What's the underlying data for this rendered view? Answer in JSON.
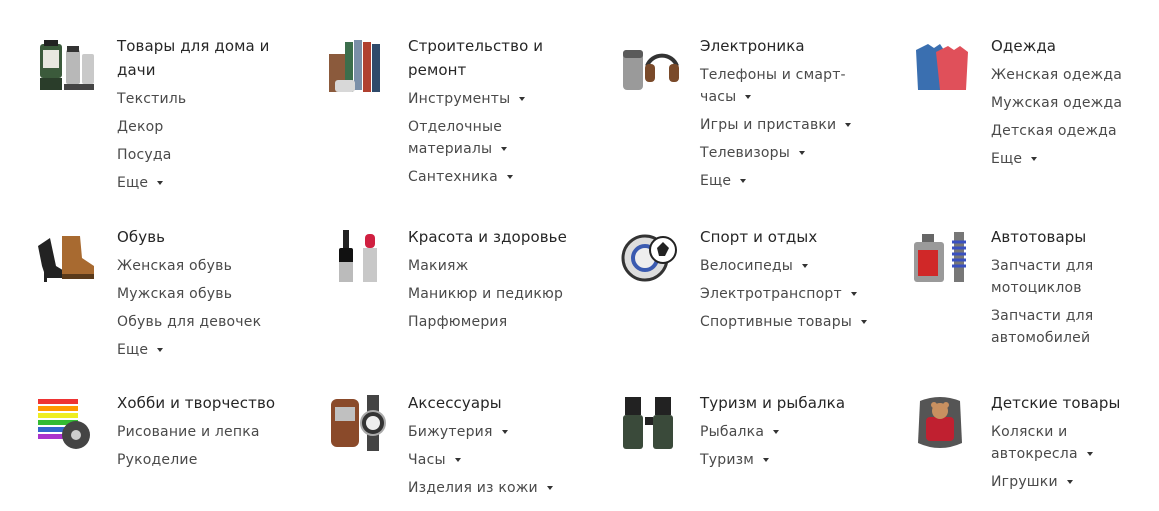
{
  "categories": [
    {
      "title": [
        "Товары для дома и",
        "дачи"
      ],
      "items": [
        {
          "lines": [
            "Текстиль"
          ],
          "arrow": false
        },
        {
          "lines": [
            "Декор"
          ],
          "arrow": false
        },
        {
          "lines": [
            "Посуда"
          ],
          "arrow": false
        },
        {
          "lines": [
            "Еще"
          ],
          "arrow": true
        }
      ]
    },
    {
      "title": [
        "Строительство и",
        "ремонт"
      ],
      "items": [
        {
          "lines": [
            "Инструменты"
          ],
          "arrow": true
        },
        {
          "lines": [
            "Отделочные",
            "материалы"
          ],
          "arrow": true
        },
        {
          "lines": [
            "Сантехника"
          ],
          "arrow": true
        }
      ]
    },
    {
      "title": [
        "Электроника"
      ],
      "items": [
        {
          "lines": [
            "Телефоны и смарт-",
            "часы"
          ],
          "arrow": true
        },
        {
          "lines": [
            "Игры и приставки"
          ],
          "arrow": true
        },
        {
          "lines": [
            "Телевизоры"
          ],
          "arrow": true
        },
        {
          "lines": [
            "Еще"
          ],
          "arrow": true
        }
      ]
    },
    {
      "title": [
        "Одежда"
      ],
      "items": [
        {
          "lines": [
            "Женская одежда"
          ],
          "arrow": false
        },
        {
          "lines": [
            "Мужская одежда"
          ],
          "arrow": false
        },
        {
          "lines": [
            "Детская одежда"
          ],
          "arrow": false
        },
        {
          "lines": [
            "Еще"
          ],
          "arrow": true
        }
      ]
    },
    {
      "title": [
        "Обувь"
      ],
      "items": [
        {
          "lines": [
            "Женская обувь"
          ],
          "arrow": false
        },
        {
          "lines": [
            "Мужская обувь"
          ],
          "arrow": false
        },
        {
          "lines": [
            "Обувь для девочек"
          ],
          "arrow": false
        },
        {
          "lines": [
            "Еще"
          ],
          "arrow": true
        }
      ]
    },
    {
      "title": [
        "Красота и здоровье"
      ],
      "items": [
        {
          "lines": [
            "Макияж"
          ],
          "arrow": false
        },
        {
          "lines": [
            "Маникюр и педикюр"
          ],
          "arrow": false
        },
        {
          "lines": [
            "Парфюмерия"
          ],
          "arrow": false
        }
      ]
    },
    {
      "title": [
        "Спорт и отдых"
      ],
      "items": [
        {
          "lines": [
            "Велосипеды"
          ],
          "arrow": true
        },
        {
          "lines": [
            "Электротранспорт"
          ],
          "arrow": true
        },
        {
          "lines": [
            "Спортивные товары"
          ],
          "arrow": true
        }
      ]
    },
    {
      "title": [
        "Автотовары"
      ],
      "items": [
        {
          "lines": [
            "Запчасти для",
            "мотоциклов"
          ],
          "arrow": false
        },
        {
          "lines": [
            "Запчасти для",
            "автомобилей"
          ],
          "arrow": false
        }
      ]
    },
    {
      "title": [
        "Хобби и творчество"
      ],
      "items": [
        {
          "lines": [
            "Рисование и лепка"
          ],
          "arrow": false
        },
        {
          "lines": [
            "Рукоделие"
          ],
          "arrow": false
        }
      ]
    },
    {
      "title": [
        "Аксессуары"
      ],
      "items": [
        {
          "lines": [
            "Бижутерия"
          ],
          "arrow": true
        },
        {
          "lines": [
            "Часы"
          ],
          "arrow": true
        },
        {
          "lines": [
            "Изделия из кожи"
          ],
          "arrow": true
        }
      ]
    },
    {
      "title": [
        "Туризм и рыбалка"
      ],
      "items": [
        {
          "lines": [
            "Рыбалка"
          ],
          "arrow": true
        },
        {
          "lines": [
            "Туризм"
          ],
          "arrow": true
        }
      ]
    },
    {
      "title": [
        "Детские товары"
      ],
      "items": [
        {
          "lines": [
            "Коляски и",
            "автокресла"
          ],
          "arrow": true
        },
        {
          "lines": [
            "Игрушки"
          ],
          "arrow": true
        }
      ]
    }
  ]
}
